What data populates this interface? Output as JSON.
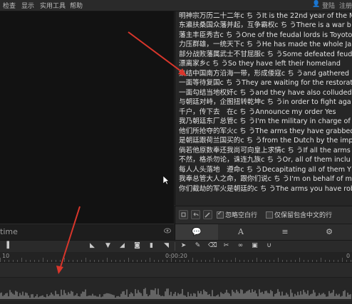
{
  "menubar": {
    "items": [
      "检查",
      "显示",
      "实用工具",
      "帮助"
    ],
    "right": {
      "login": "登陆",
      "register": "注册"
    }
  },
  "preview": {
    "clip_name": "time"
  },
  "subtitles": [
    "明神宗万历二十二年c ち うIt is the 22nd year of the M",
    "东瀛扶桑国众藩并起，互争霸权c ち うThere is a war b",
    "藩主丰臣秀吉c ち うOne of the feudal lords is Toyoto",
    "力压群雄，一统天下c ち うHe has made the whole Jap",
    "部分战败藩属武士不甘屈服c ち うSome defeated feud",
    "漂离家乡c ち うSo they have left their homeland",
    "集结中国南方沿海一带，形成倭寇c ち うand gathered",
    "一面等待复国c ち うThey are waiting for the restorat",
    "一面勾结当地权奸c ち うand they have also colluded",
    "与朝廷对峙，企图扭转乾坤c ち うin order to fight aga",
    "千户，传下去　在c ち うAnnounce my order Yes",
    "我乃朝廷东厂总管c ち うI'm the military in charge of",
    "他们所抢夺的军火c ち うThe arms they have grabbed",
    "是朝廷跟荷兰国买的c ち うfrom the Dutch by the imp",
    "倘若他原数奉还我尚可向皇上求情c ち うIf all the arms",
    "不然，格杀勿论，诛连九族c ち うOr, all of them inclu",
    "每人人头落地　遵命c ち うDecapitating all of them Y",
    "我奉总管大人之命，跟你们说c ち うI'm on behalf of m",
    "你们截劫的军火是朝廷的c ち うThe arms you have rob"
  ],
  "options": {
    "ignore_blank_lines": "忽略空白行",
    "keep_chinese_only": "仅保留包含中文的行",
    "ignore_blank_checked": true,
    "keep_chinese_checked": false
  },
  "tabs": [
    {
      "icon": "speech-bubble-icon",
      "label": "💬"
    },
    {
      "icon": "text-style-icon",
      "label": "A"
    },
    {
      "icon": "bars-icon",
      "label": "≡"
    },
    {
      "icon": "gear-icon",
      "label": "⚙"
    }
  ],
  "ruler": {
    "labels": [
      "10",
      "0:00:20",
      "0"
    ]
  },
  "colors": {
    "accent_arrow": "#d9362b"
  }
}
